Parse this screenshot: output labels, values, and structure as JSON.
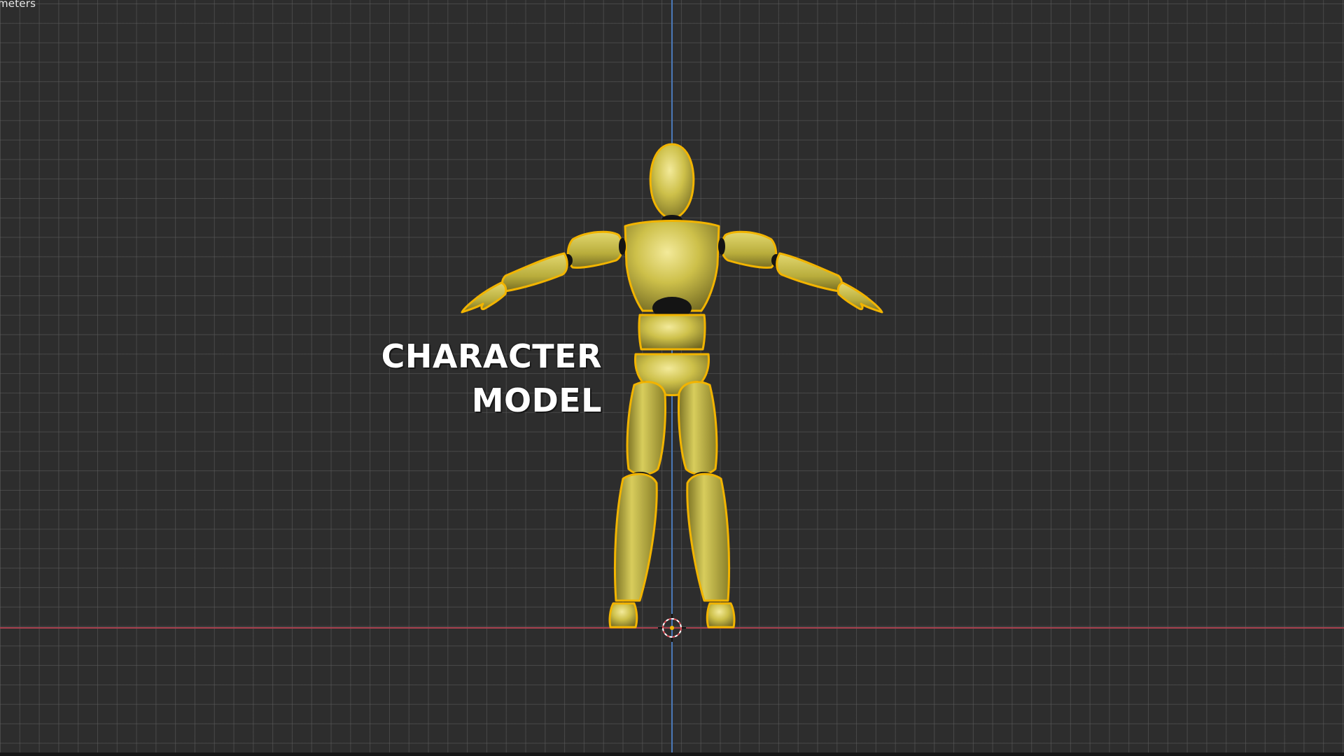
{
  "viewport": {
    "units_label": "meters",
    "background_color": "#2d2d2d",
    "grid_color": "#5f5f5f",
    "axis_z_color": "#4a78b8",
    "axis_x_color": "#a8404f"
  },
  "overlay_caption": {
    "line1": "CHARACTER",
    "line2": "MODEL"
  },
  "character": {
    "body_color": "#cdc04a",
    "selection_outline_color": "#f2b400",
    "joint_color": "#141414"
  },
  "icons": {
    "origin": "3d-cursor-icon"
  }
}
